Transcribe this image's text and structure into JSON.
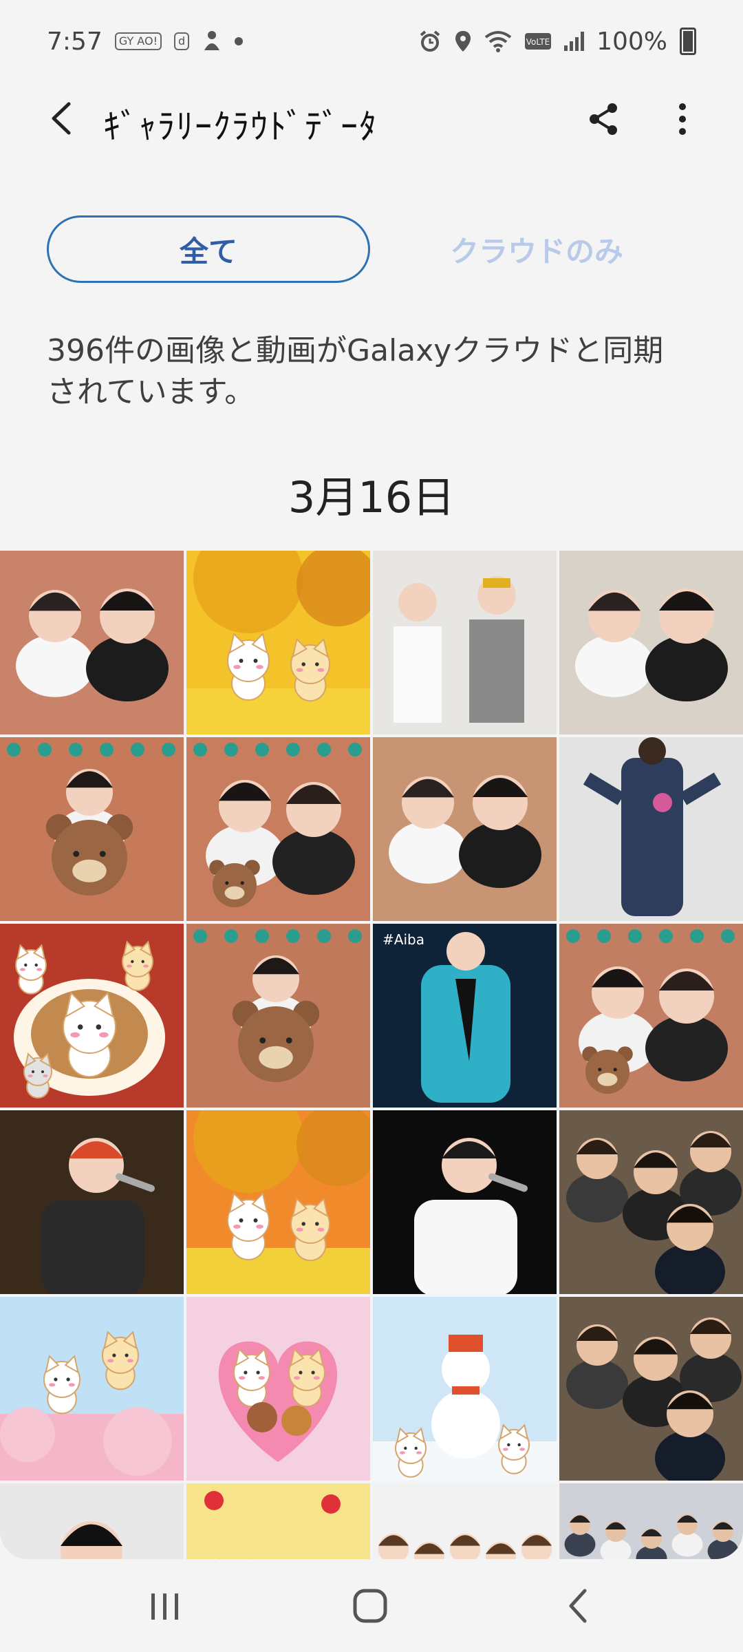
{
  "status_bar": {
    "time": "7:57",
    "notif_icons": [
      "GY AO!",
      "d"
    ],
    "battery_text": "100%"
  },
  "header": {
    "title": "ｷﾞｬﾗﾘｰｸﾗｳﾄﾞﾃﾞｰﾀ"
  },
  "tabs": {
    "all_label": "全て",
    "cloud_only_label": "クラウドのみ"
  },
  "description": "396件の画像と動画がGalaxyクラウドと同期されています。",
  "date_header": "3月16日",
  "colors": {
    "accent": "#2f6fb4",
    "inactive_tab": "#b9c9ea",
    "background": "#f4f4f4"
  },
  "thumbnails": [
    {
      "kind": "selfie-two",
      "bg": "#c9836b",
      "caption": ""
    },
    {
      "kind": "autumn-cats",
      "bg": "#f4c329",
      "caption": ""
    },
    {
      "kind": "two-men-standing",
      "bg": "#e8e6e2",
      "caption": ""
    },
    {
      "kind": "selfie-two",
      "bg": "#d9d2c8",
      "caption": ""
    },
    {
      "kind": "man-bear",
      "bg": "#c77a5a",
      "caption": ""
    },
    {
      "kind": "selfie-two-bear",
      "bg": "#c97d5f",
      "caption": ""
    },
    {
      "kind": "selfie-two",
      "bg": "#c89574",
      "caption": ""
    },
    {
      "kind": "overalls",
      "bg": "#e3e3e3",
      "caption": ""
    },
    {
      "kind": "cats-latte",
      "bg": "#b83a2a",
      "caption": ""
    },
    {
      "kind": "man-bear",
      "bg": "#c07a5b",
      "caption": ""
    },
    {
      "kind": "performer",
      "bg": "#0e2238",
      "caption": "#Aiba"
    },
    {
      "kind": "selfie-two-bear",
      "bg": "#c27e62",
      "caption": ""
    },
    {
      "kind": "singer",
      "bg": "#3a2a1c",
      "caption": ""
    },
    {
      "kind": "autumn-cats",
      "bg": "#f08a2a",
      "caption": ""
    },
    {
      "kind": "singer",
      "bg": "#0c0c0c",
      "caption": ""
    },
    {
      "kind": "group",
      "bg": "#6a5a4a",
      "caption": ""
    },
    {
      "kind": "sakura-cats",
      "bg": "#bfe0f5",
      "caption": ""
    },
    {
      "kind": "heart-cats",
      "bg": "#f5d0e0",
      "caption": ""
    },
    {
      "kind": "snowman",
      "bg": "#cfe6f7",
      "caption": ""
    },
    {
      "kind": "group",
      "bg": "#6a5a4a",
      "caption": ""
    },
    {
      "kind": "portrait",
      "bg": "#e8e8e8",
      "caption": ""
    },
    {
      "kind": "strawberry-cats",
      "bg": "#f7e48a",
      "caption": ""
    },
    {
      "kind": "cartoon-group",
      "bg": "#f2f2f2",
      "caption": ""
    },
    {
      "kind": "group-dance",
      "bg": "#ced2d8",
      "caption": ""
    }
  ]
}
